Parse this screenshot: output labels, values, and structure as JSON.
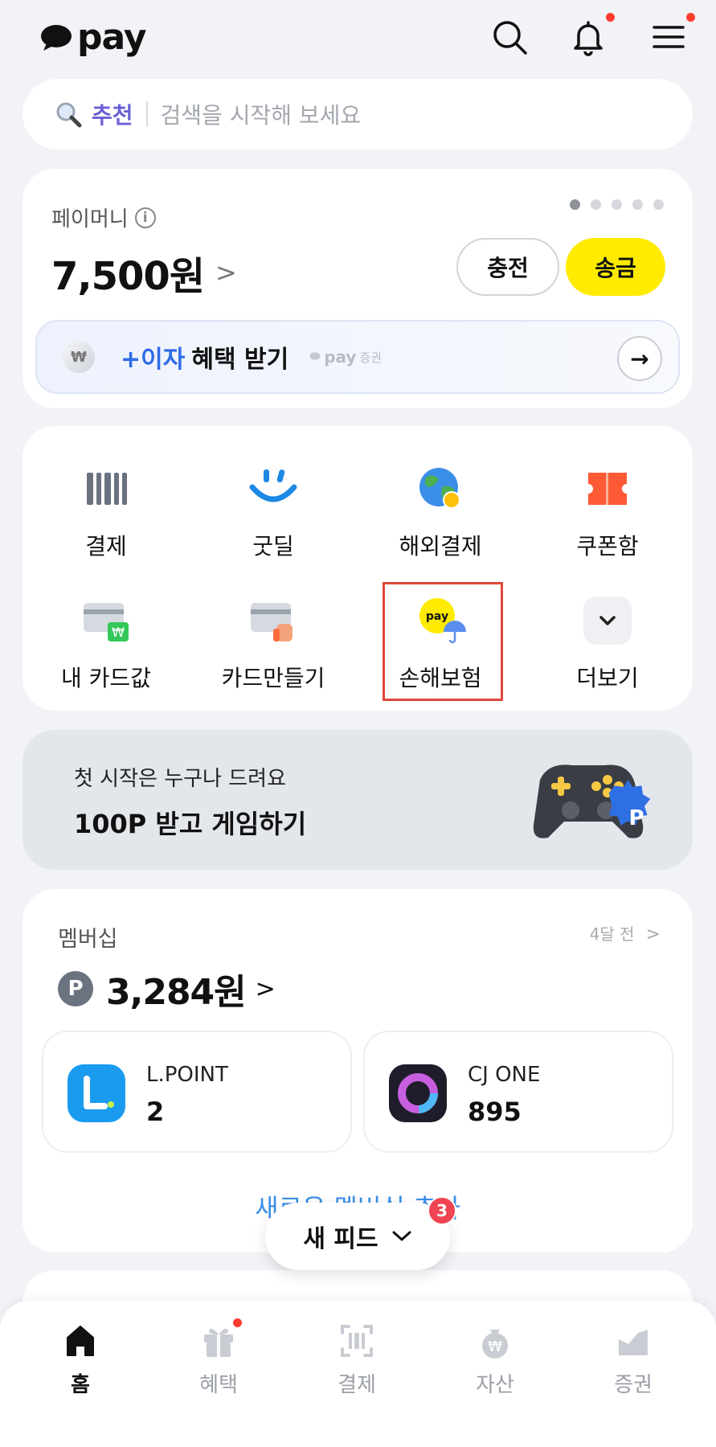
{
  "header": {
    "logo_text": "pay",
    "icons": [
      "search-icon",
      "bell-icon",
      "menu-icon"
    ]
  },
  "search": {
    "keyword": "추천",
    "placeholder": "검색을 시작해 보세요"
  },
  "pay_money": {
    "label": "페이머니",
    "amount": "7,500원",
    "charge_label": "충전",
    "send_label": "송금",
    "page_count": 5,
    "active_page": 1,
    "interest": {
      "plus": "+이자",
      "text": "혜택 받기",
      "brand": "pay",
      "brand_sub": "증권",
      "coin_symbol": "₩"
    }
  },
  "quick_menu": {
    "items": [
      {
        "label": "결제",
        "icon": "barcode-icon"
      },
      {
        "label": "굿딜",
        "icon": "smile-icon"
      },
      {
        "label": "해외결제",
        "icon": "globe-icon"
      },
      {
        "label": "쿠폰함",
        "icon": "coupon-icon"
      },
      {
        "label": "내 카드값",
        "icon": "card-won-icon"
      },
      {
        "label": "카드만들기",
        "icon": "card-make-icon"
      },
      {
        "label": "손해보험",
        "icon": "insurance-icon",
        "badge": "pay"
      },
      {
        "label": "더보기",
        "icon": "chevron-down-icon"
      }
    ]
  },
  "banner": {
    "line1": "첫 시작은 누구나 드려요",
    "line2": "100P 받고 게임하기"
  },
  "membership": {
    "title": "멤버십",
    "updated": "4달 전",
    "point_symbol": "P",
    "points": "3,284원",
    "cards": [
      {
        "name": "L.POINT",
        "value": "2"
      },
      {
        "name": "CJ ONE",
        "value": "895"
      }
    ],
    "new_link": "새로운 멤버십 추가"
  },
  "feed": {
    "label": "새 피드",
    "badge": "3"
  },
  "tabbar": {
    "tabs": [
      {
        "label": "홈",
        "icon": "home-icon"
      },
      {
        "label": "혜택",
        "icon": "gift-icon"
      },
      {
        "label": "결제",
        "icon": "scan-pay-icon"
      },
      {
        "label": "자산",
        "icon": "money-bag-icon"
      },
      {
        "label": "증권",
        "icon": "chart-icon"
      }
    ]
  },
  "colors": {
    "accent_yellow": "#ffeb00",
    "keyword_purple": "#6a5fd6",
    "link_blue": "#3b8ee8",
    "alert_red": "#ff3b30",
    "highlight_red": "#e0473a"
  }
}
